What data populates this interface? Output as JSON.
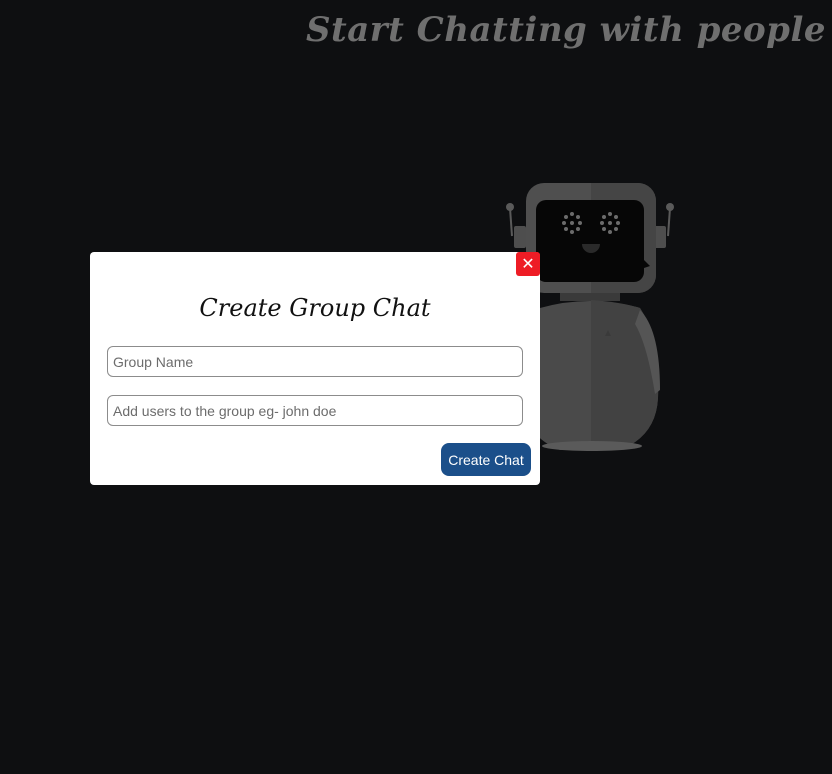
{
  "header": {
    "title": "Start Chatting with people"
  },
  "illustration": {
    "icon": "robot-icon"
  },
  "modal": {
    "title": "Create Group Chat",
    "close_label": "✕",
    "group_name_placeholder": "Group Name",
    "add_users_placeholder": "Add users to the group eg- john doe",
    "submit_label": "Create Chat"
  },
  "colors": {
    "background": "#0e0f11",
    "close_button": "#ee1c25",
    "primary_button": "#1b4f8a",
    "title_text": "#6f6f6f"
  }
}
